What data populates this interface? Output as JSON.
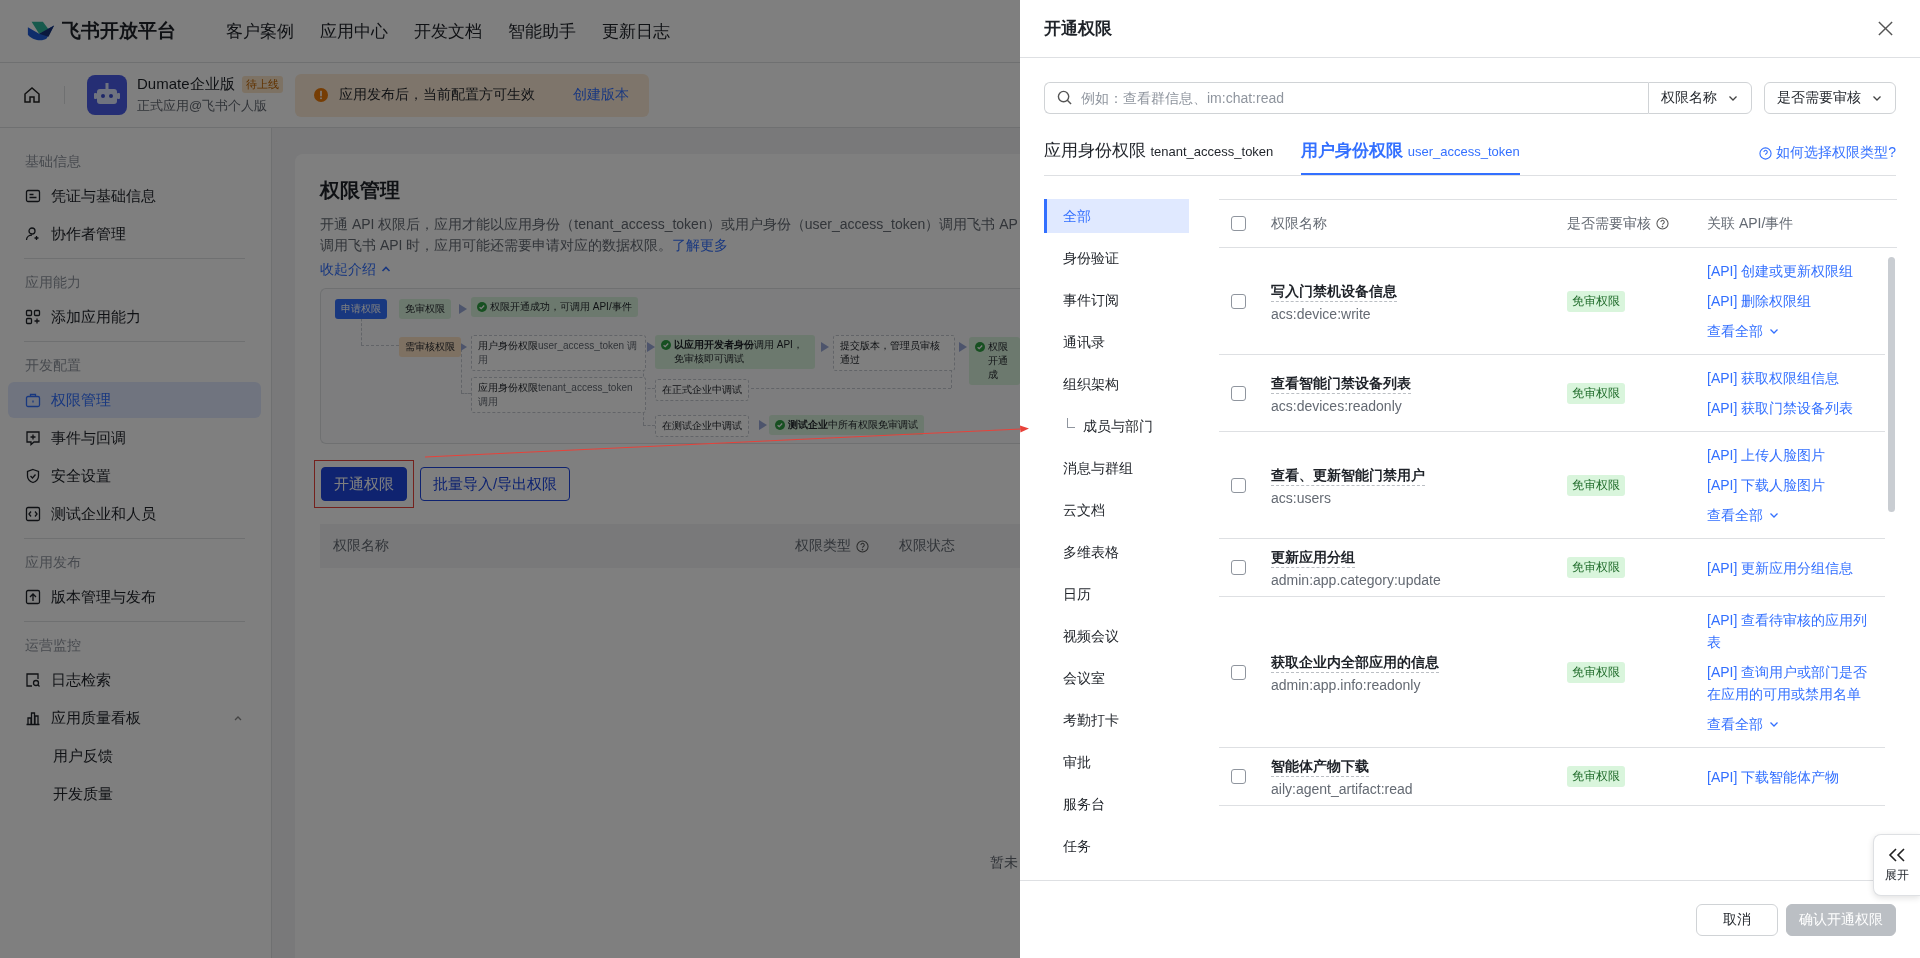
{
  "header": {
    "logo": "飞书开放平台",
    "nav": [
      "客户案例",
      "应用中心",
      "开发文档",
      "智能助手",
      "更新日志"
    ]
  },
  "app_bar": {
    "name": "Dumate企业版",
    "badge": "待上线",
    "subtitle": "正式应用@飞书个人版",
    "notice": "应用发布后，当前配置方可生效",
    "notice_link": "创建版本"
  },
  "sidebar": {
    "sections": [
      {
        "title": "基础信息",
        "items": [
          {
            "label": "凭证与基础信息",
            "selected": false
          },
          {
            "label": "协作者管理",
            "selected": false
          }
        ]
      },
      {
        "title": "应用能力",
        "items": [
          {
            "label": "添加应用能力",
            "selected": false
          }
        ]
      },
      {
        "title": "开发配置",
        "items": [
          {
            "label": "权限管理",
            "selected": true
          },
          {
            "label": "事件与回调",
            "selected": false
          },
          {
            "label": "安全设置",
            "selected": false
          },
          {
            "label": "测试企业和人员",
            "selected": false
          }
        ]
      },
      {
        "title": "应用发布",
        "items": [
          {
            "label": "版本管理与发布",
            "selected": false
          }
        ]
      },
      {
        "title": "运营监控",
        "items": [
          {
            "label": "日志检索",
            "selected": false
          },
          {
            "label": "应用质量看板",
            "selected": false,
            "expanded": true,
            "children": [
              {
                "label": "用户反馈",
                "selected": false
              },
              {
                "label": "开发质量",
                "selected": false
              }
            ]
          }
        ]
      }
    ]
  },
  "page": {
    "title": "权限管理",
    "description_lines": [
      "开通 API 权限后，应用才能以应用身份（tenant_access_token）或用户身份（user_access_token）调用飞书 AP",
      "调用飞书 API 时，应用可能还需要申请对应的数据权限。"
    ],
    "learn_more": "了解更多",
    "collapse": "收起介绍",
    "flow": [
      {
        "text": "申请权限",
        "kind": "start"
      },
      {
        "text": "免审权限",
        "kind": "green"
      },
      {
        "text": "权限开通成功，可调用 API/事件",
        "kind": "success"
      },
      {
        "text": "需审核权限",
        "kind": "orange"
      },
      {
        "text": "用户身份权限",
        "note": "user_access_token 调用",
        "kind": "plain"
      },
      {
        "text": "**以应用开发者身份**调用 API，免审核即可调试",
        "kind": "success"
      },
      {
        "text": "提交版本，管理员审核通过",
        "kind": "plain"
      },
      {
        "text": "权限开通成",
        "kind": "success"
      },
      {
        "text": "应用身份权限",
        "note": "tenant_access_token 调用",
        "kind": "plain"
      },
      {
        "text": "在正式企业中调试",
        "kind": "plain"
      },
      {
        "text": "在测试企业中调试",
        "kind": "plain"
      },
      {
        "text": "**测试企业**中所有权限免审调试",
        "kind": "success"
      }
    ],
    "buttons": [
      {
        "label": "开通权限",
        "kind": "primary"
      },
      {
        "label": "批量导入/导出权限",
        "kind": "outline"
      }
    ],
    "table": {
      "columns": [
        "权限名称",
        "权限类型",
        "权限状态"
      ],
      "empty": "暂未"
    }
  },
  "drawer": {
    "title": "开通权限",
    "search": {
      "placeholder": "例如：查看群信息、im:chat:read"
    },
    "filters": [
      "权限名称",
      "是否需要审核"
    ],
    "tabs": [
      {
        "label": "应用身份权限",
        "token": "tenant_access_token",
        "selected": false
      },
      {
        "label": "用户身份权限",
        "token": "user_access_token",
        "selected": true
      }
    ],
    "help_link": "如何选择权限类型?",
    "categories": [
      {
        "label": "全部",
        "selected": true
      },
      {
        "label": "身份验证",
        "selected": false
      },
      {
        "label": "事件订阅",
        "selected": false
      },
      {
        "label": "通讯录",
        "selected": false
      },
      {
        "label": "组织架构",
        "selected": false,
        "children": [
          {
            "label": "成员与部门",
            "selected": false
          }
        ]
      },
      {
        "label": "消息与群组",
        "selected": false
      },
      {
        "label": "云文档",
        "selected": false
      },
      {
        "label": "多维表格",
        "selected": false
      },
      {
        "label": "日历",
        "selected": false
      },
      {
        "label": "视频会议",
        "selected": false
      },
      {
        "label": "会议室",
        "selected": false
      },
      {
        "label": "考勤打卡",
        "selected": false
      },
      {
        "label": "审批",
        "selected": false
      },
      {
        "label": "服务台",
        "selected": false
      },
      {
        "label": "任务",
        "selected": false
      }
    ],
    "columns": [
      "权限名称",
      "是否需要审核",
      "关联 API/事件"
    ],
    "select_all": {
      "checked": false
    },
    "rows": [
      {
        "checked": false,
        "name": "写入门禁机设备信息",
        "scope": "acs:device:write",
        "review": "免审权限",
        "apis": [
          "[API] 创建或更新权限组",
          "[API] 删除权限组"
        ],
        "more": "查看全部"
      },
      {
        "checked": false,
        "name": "查看智能门禁设备列表",
        "scope": "acs:devices:readonly",
        "review": "免审权限",
        "apis": [
          "[API] 获取权限组信息",
          "[API] 获取门禁设备列表"
        ]
      },
      {
        "checked": false,
        "name": "查看、更新智能门禁用户",
        "scope": "acs:users",
        "review": "免审权限",
        "apis": [
          "[API] 上传人脸图片",
          "[API] 下载人脸图片"
        ],
        "more": "查看全部"
      },
      {
        "checked": false,
        "name": "更新应用分组",
        "scope": "admin:app.category:update",
        "review": "免审权限",
        "apis": [
          "[API] 更新应用分组信息"
        ]
      },
      {
        "checked": false,
        "name": "获取企业内全部应用的信息",
        "scope": "admin:app.info:readonly",
        "review": "免审权限",
        "apis": [
          "[API] 查看待审核的应用列表",
          "[API] 查询用户或部门是否在应用的可用或禁用名单"
        ],
        "more": "查看全部"
      },
      {
        "checked": false,
        "name": "智能体产物下载",
        "scope": "aily:agent_artifact:read",
        "review": "免审权限",
        "apis": [
          "[API] 下载智能体产物"
        ]
      }
    ],
    "footer": [
      {
        "label": "取消",
        "disabled": false
      },
      {
        "label": "确认开通权限",
        "disabled": true
      }
    ],
    "expand_tab": "展开"
  }
}
